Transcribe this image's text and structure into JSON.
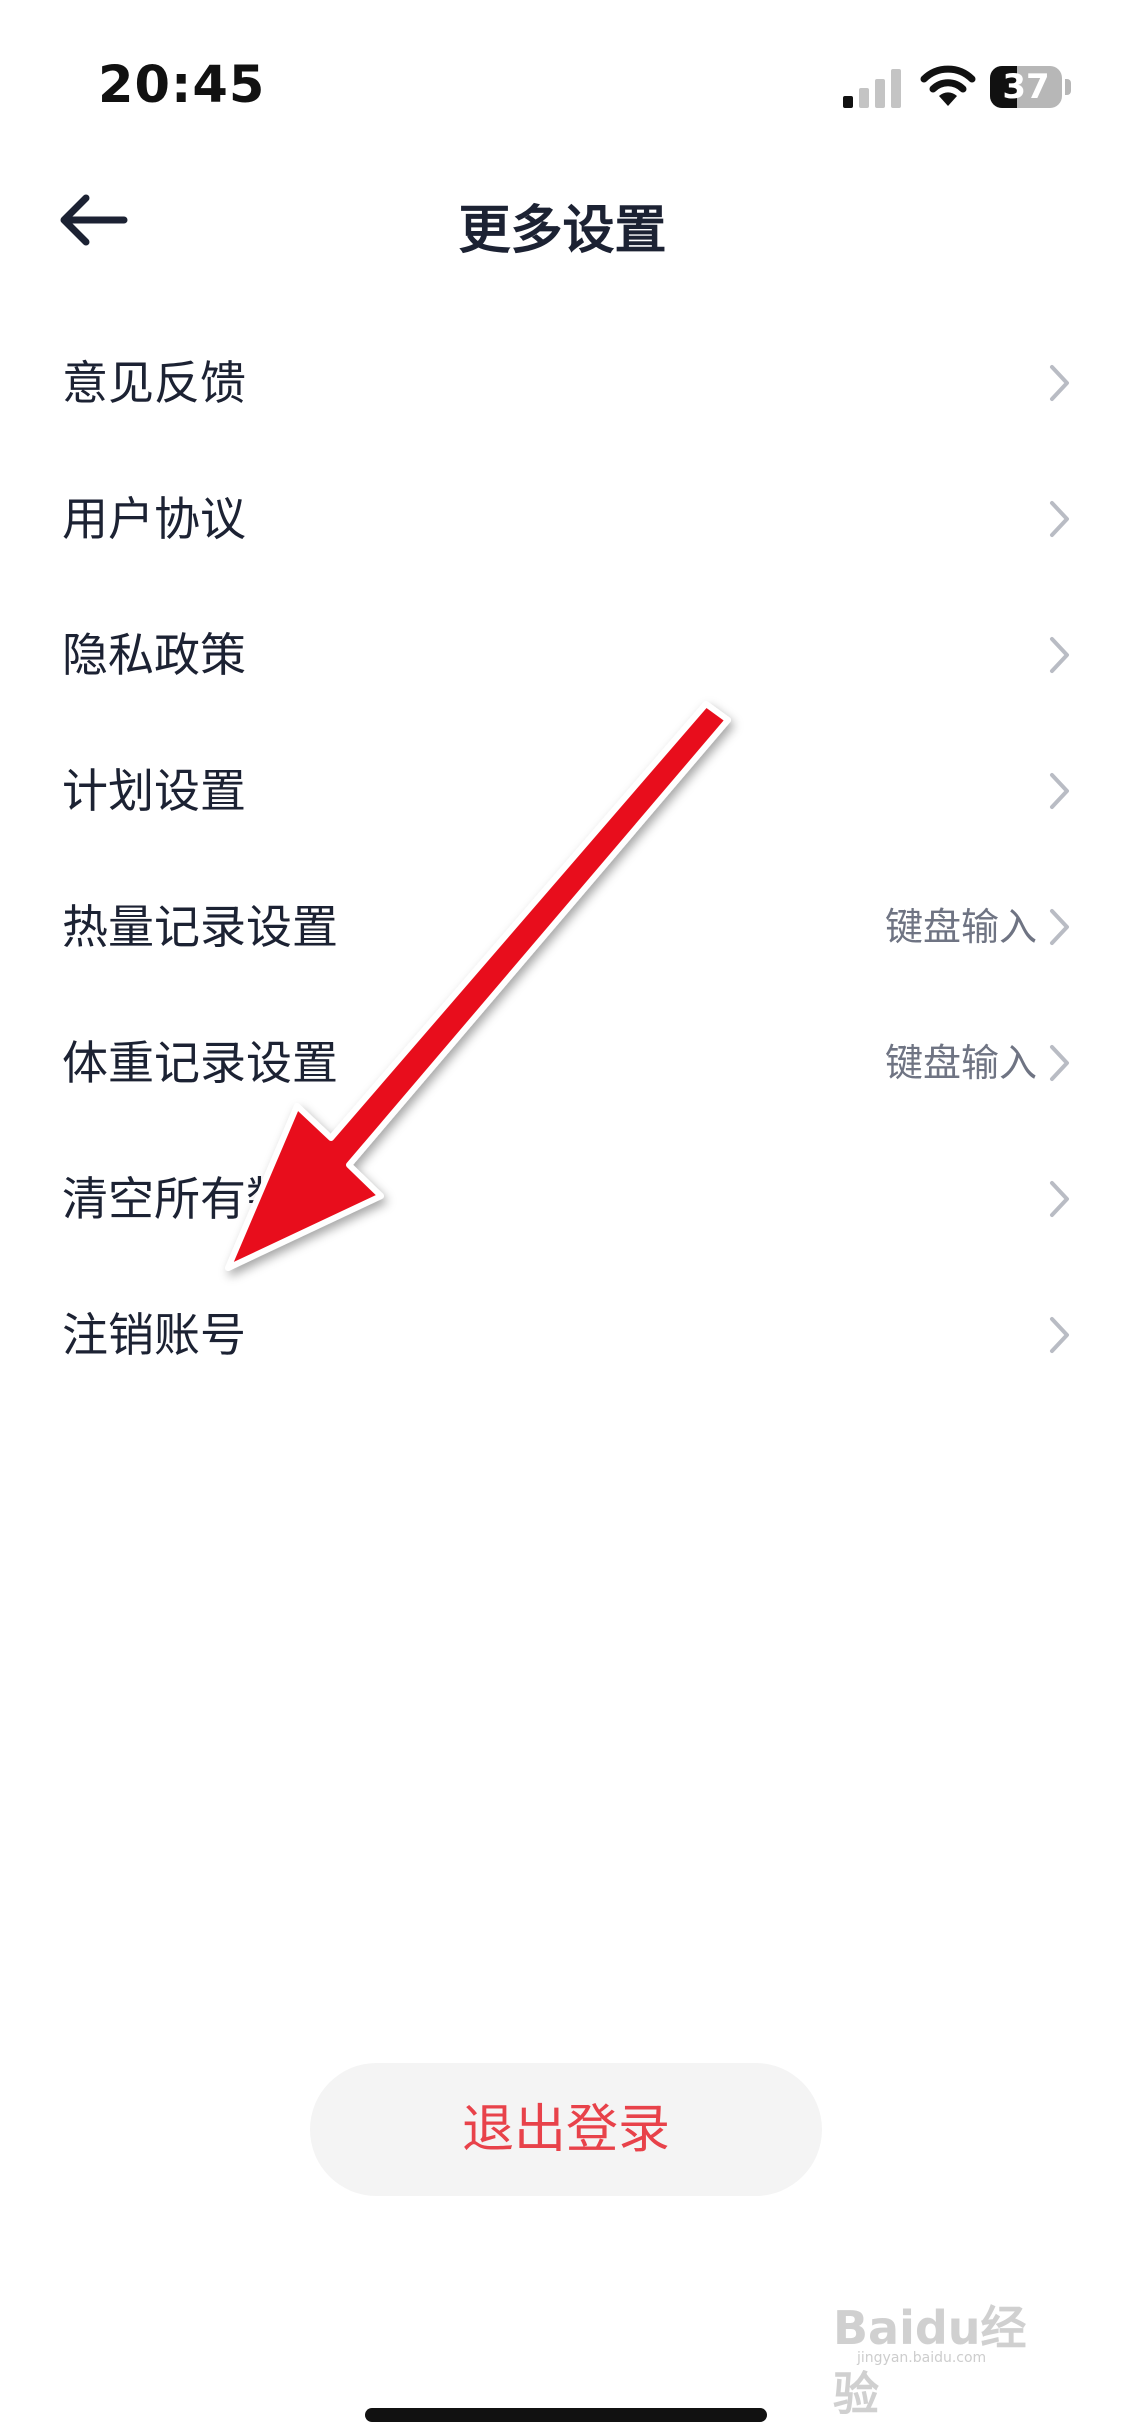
{
  "status_bar": {
    "time": "20:45",
    "battery_level": "37",
    "battery_fraction": 0.37
  },
  "header": {
    "title": "更多设置",
    "back_icon": "arrow-left-icon"
  },
  "settings": {
    "items": [
      {
        "label": "意见反馈",
        "value": ""
      },
      {
        "label": "用户协议",
        "value": ""
      },
      {
        "label": "隐私政策",
        "value": ""
      },
      {
        "label": "计划设置",
        "value": ""
      },
      {
        "label": "热量记录设置",
        "value": "键盘输入"
      },
      {
        "label": "体重记录设置",
        "value": "键盘输入"
      },
      {
        "label": "清空所有数据",
        "value": ""
      },
      {
        "label": "注销账号",
        "value": ""
      }
    ],
    "chevron_icon": "chevron-right-icon"
  },
  "logout": {
    "label": "退出登录"
  },
  "watermark": {
    "text": "Baidu经验",
    "url": "jingyan.baidu.com"
  },
  "colors": {
    "text_primary": "#1c2233",
    "text_secondary": "#6f7483",
    "logout_text": "#e8424a",
    "logout_bg": "#f4f4f4",
    "annotation_arrow": "#e8101a"
  }
}
